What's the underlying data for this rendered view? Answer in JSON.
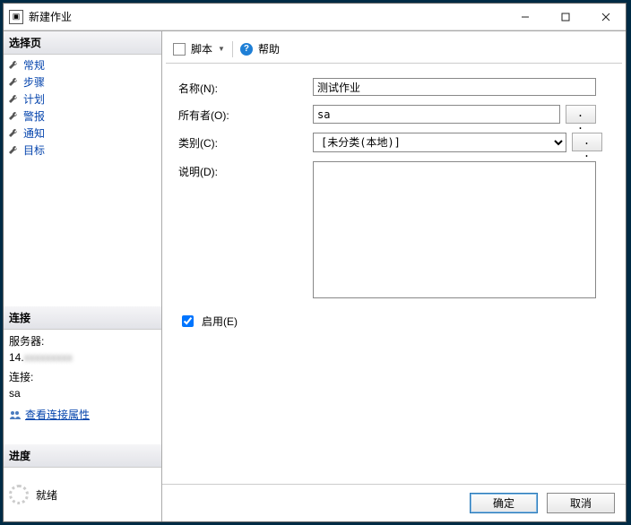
{
  "window": {
    "title": "新建作业"
  },
  "winbuttons": {
    "min": "—",
    "max": "☐",
    "close": "✕"
  },
  "sidebar": {
    "select_page_header": "选择页",
    "pages": [
      {
        "label": "常规",
        "selected": true
      },
      {
        "label": "步骤",
        "selected": false
      },
      {
        "label": "计划",
        "selected": false
      },
      {
        "label": "警报",
        "selected": false
      },
      {
        "label": "通知",
        "selected": false
      },
      {
        "label": "目标",
        "selected": false
      }
    ],
    "connection_header": "连接",
    "server_label": "服务器:",
    "server_value": "14.",
    "connection_label": "连接:",
    "connection_value": "sa",
    "view_props": "查看连接属性",
    "progress_header": "进度",
    "progress_status": "就绪"
  },
  "toolbar": {
    "script": "脚本",
    "help": "帮助"
  },
  "form": {
    "name_label": "名称(N):",
    "name_value": "测试作业",
    "owner_label": "所有者(O):",
    "owner_value": "sa",
    "owner_browse": ". . .",
    "category_label": "类别(C):",
    "category_value": "[未分类(本地)]",
    "category_browse": ". . .",
    "desc_label": "说明(D):",
    "desc_value": "",
    "enable_label": "启用(E)",
    "enable_checked": true
  },
  "footer": {
    "ok": "确定",
    "cancel": "取消"
  }
}
